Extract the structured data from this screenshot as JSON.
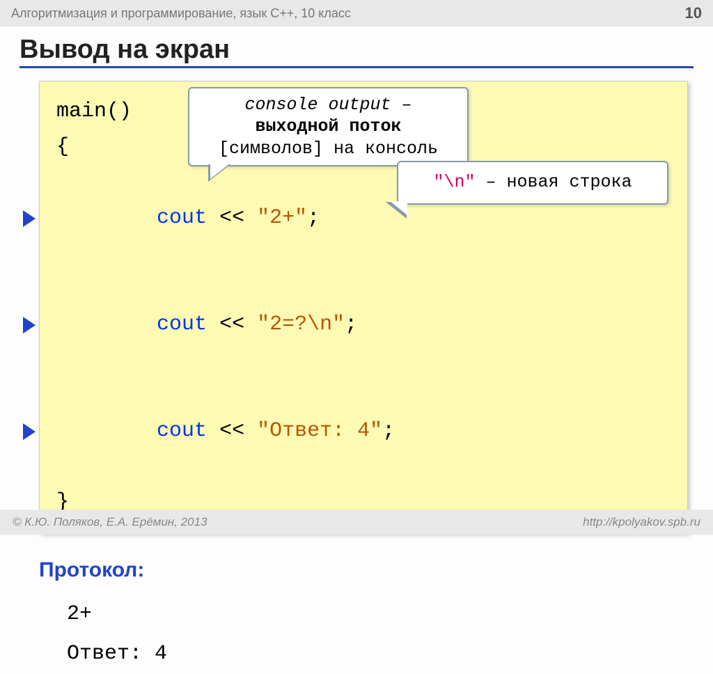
{
  "header": {
    "breadcrumb": "Алгоритмизация и программирование, язык  C++, 10 класс",
    "page_number": "10"
  },
  "title": "Вывод на экран",
  "code": {
    "line1": "main()",
    "line2": "{",
    "cout": "cout",
    "lshift": " << ",
    "str1": "\"2+\"",
    "str2": "\"2=?\\n\"",
    "str3": "\"Ответ: 4\"",
    "semicolon": ";",
    "line_close": "}"
  },
  "callout1": {
    "italic": "console output",
    "dash": " – ",
    "bold1": "выходной поток",
    "rest": " [символов] на консоль"
  },
  "callout2": {
    "escape": "\"\\n\"",
    "rest": " – новая строка"
  },
  "protocol": {
    "title": "Протокол:",
    "line1": "2+",
    "line2": "Ответ: 4"
  },
  "footer": {
    "copyright": " К.Ю. Поляков, Е.А. Ерёмин, 2013",
    "url": "http://kpolyakov.spb.ru"
  }
}
